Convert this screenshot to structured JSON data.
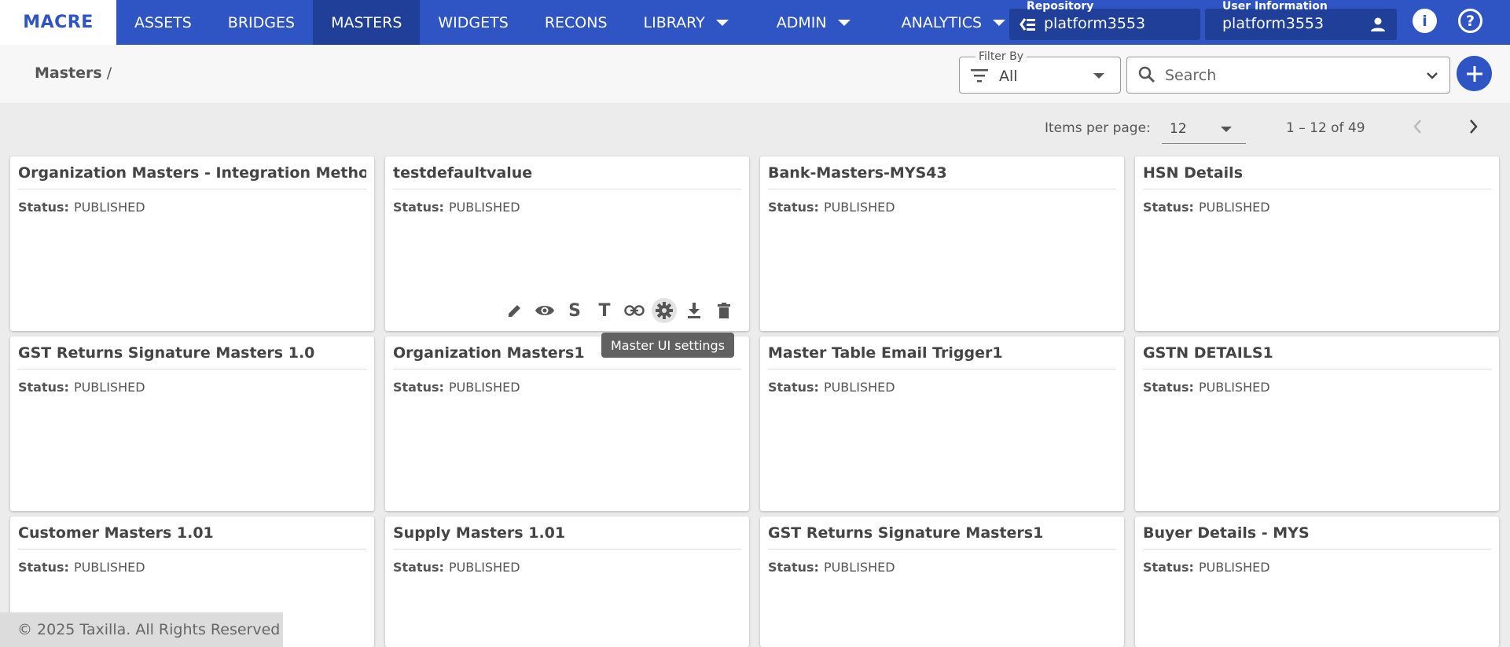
{
  "nav": {
    "logo": "MACRE",
    "items": [
      {
        "label": "ASSETS"
      },
      {
        "label": "BRIDGES"
      },
      {
        "label": "MASTERS"
      },
      {
        "label": "WIDGETS"
      },
      {
        "label": "RECONS"
      },
      {
        "label": "LIBRARY"
      },
      {
        "label": "ADMIN"
      },
      {
        "label": "ANALYTICS"
      }
    ],
    "active_item": "MASTERS"
  },
  "repository": {
    "label": "Repository",
    "value": "platform3553"
  },
  "user_info": {
    "label": "User Information",
    "value": "platform3553"
  },
  "breadcrumb": {
    "current": "Masters",
    "separator": "/"
  },
  "filter": {
    "label": "Filter By",
    "value": "All"
  },
  "search": {
    "placeholder": "Search"
  },
  "pagination": {
    "label": "Items per page:",
    "per_page": "12",
    "range": "1 – 12 of 49"
  },
  "status_label": "Status:",
  "cards": [
    {
      "title": "Organization Masters - Integration Method",
      "status": "PUBLISHED"
    },
    {
      "title": "testdefaultvalue",
      "status": "PUBLISHED"
    },
    {
      "title": "Bank-Masters-MYS43",
      "status": "PUBLISHED"
    },
    {
      "title": "HSN Details",
      "status": "PUBLISHED"
    },
    {
      "title": "GST Returns Signature Masters 1.0",
      "status": "PUBLISHED"
    },
    {
      "title": "Organization Masters1",
      "status": "PUBLISHED"
    },
    {
      "title": "Master Table Email Trigger1",
      "status": "PUBLISHED"
    },
    {
      "title": "GSTN DETAILS1",
      "status": "PUBLISHED"
    },
    {
      "title": "Customer Masters 1.01",
      "status": "PUBLISHED"
    },
    {
      "title": "Supply Masters 1.01",
      "status": "PUBLISHED"
    },
    {
      "title": "GST Returns Signature Masters1",
      "status": "PUBLISHED"
    },
    {
      "title": "Buyer Details - MYS",
      "status": "PUBLISHED"
    }
  ],
  "card_actions": [
    {
      "icon": "pencil-icon"
    },
    {
      "icon": "eye-icon"
    },
    {
      "icon": "letter-s-icon",
      "text": "S"
    },
    {
      "icon": "letter-t-icon",
      "text": "T"
    },
    {
      "icon": "link-icon"
    },
    {
      "icon": "gear-icon"
    },
    {
      "icon": "download-icon"
    },
    {
      "icon": "trash-icon"
    }
  ],
  "tooltip": "Master UI settings",
  "footer": "© 2025 Taxilla. All Rights Reserved",
  "colors": {
    "primary": "#2f55c4",
    "primary_dark": "#1f3f98",
    "background": "#ececec"
  }
}
